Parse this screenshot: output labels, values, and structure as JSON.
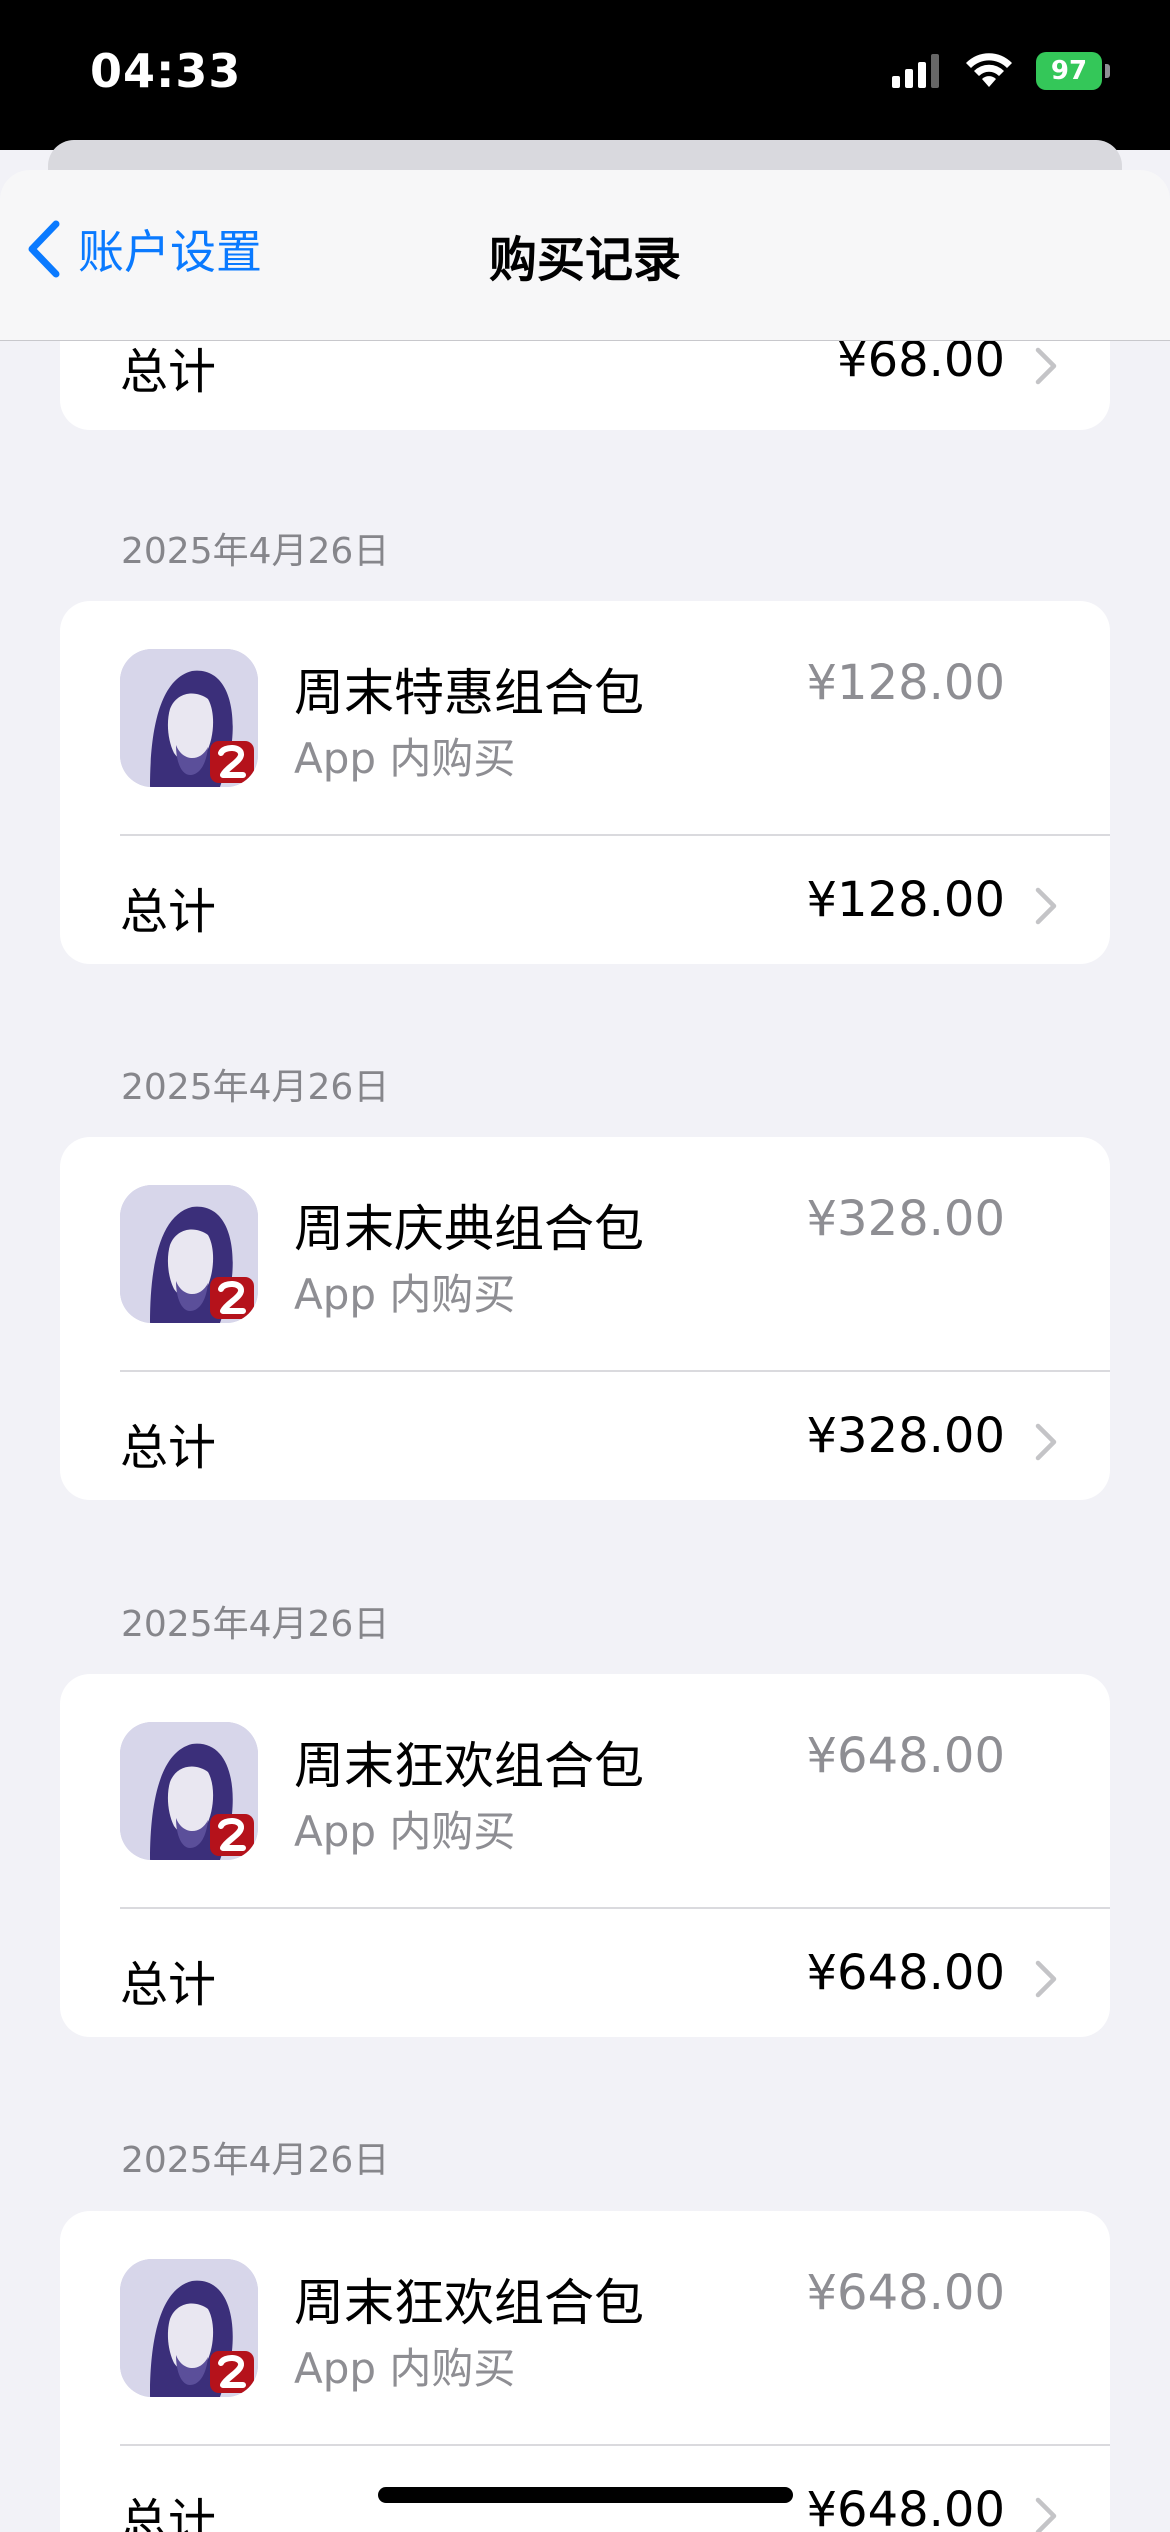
{
  "status_bar": {
    "time": "04:33",
    "battery": "97"
  },
  "nav": {
    "back_label": "账户设置",
    "title": "购买记录"
  },
  "top_partial": {
    "total_label": "总计",
    "total_price": "¥68.00"
  },
  "purchases": [
    {
      "date": "2025年4月26日",
      "item_name": "周末特惠组合包",
      "item_type": "App 内购买",
      "item_price": "¥128.00",
      "total_label": "总计",
      "total_price": "¥128.00"
    },
    {
      "date": "2025年4月26日",
      "item_name": "周末庆典组合包",
      "item_type": "App 内购买",
      "item_price": "¥328.00",
      "total_label": "总计",
      "total_price": "¥328.00"
    },
    {
      "date": "2025年4月26日",
      "item_name": "周末狂欢组合包",
      "item_type": "App 内购买",
      "item_price": "¥648.00",
      "total_label": "总计",
      "total_price": "¥648.00"
    },
    {
      "date": "2025年4月26日",
      "item_name": "周末狂欢组合包",
      "item_type": "App 内购买",
      "item_price": "¥648.00",
      "total_label": "总计",
      "total_price": "¥648.00"
    }
  ],
  "icons": {
    "back": "chevron-left-icon",
    "row": "chevron-right-icon",
    "app": "game-app-icon",
    "signal": "cellular-signal-icon",
    "wifi": "wifi-icon",
    "battery": "battery-icon"
  },
  "colors": {
    "accent": "#0a7aff",
    "background": "#f2f2f7",
    "battery": "#34c759",
    "secondary_text": "#8e8e93"
  }
}
